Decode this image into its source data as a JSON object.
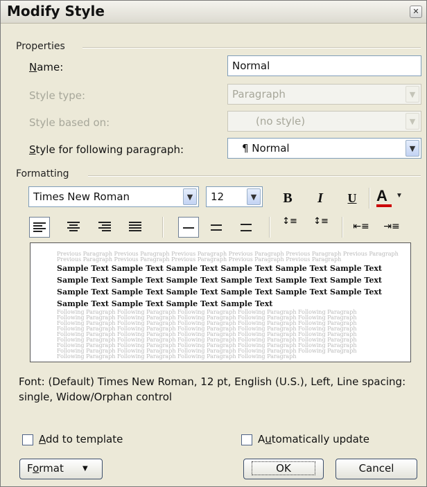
{
  "window": {
    "title": "Modify Style"
  },
  "properties": {
    "group_label": "Properties",
    "name_label": "Name:",
    "name_value": "Normal",
    "style_type_label": "Style type:",
    "style_type_value": "Paragraph",
    "based_on_label": "Style based on:",
    "based_on_value": "(no style)",
    "following_label": "Style for following paragraph:",
    "following_value": "¶ Normal"
  },
  "formatting": {
    "group_label": "Formatting",
    "font_name": "Times New Roman",
    "font_size": "12",
    "bold_label": "B",
    "italic_label": "I",
    "underline_label": "U",
    "font_color_label": "A",
    "font_color": "#cc0000"
  },
  "preview": {
    "previous_lines": [
      "Previous Paragraph Previous Paragraph Previous Paragraph Previous Paragraph Previous Paragraph Previous Paragraph",
      "Previous Paragraph Previous Paragraph Previous Paragraph Previous Paragraph Previous Paragraph"
    ],
    "sample_lines": [
      "Sample Text Sample Text Sample Text Sample Text Sample Text Sample Text",
      "Sample Text Sample Text Sample Text Sample Text Sample Text Sample Text",
      "Sample Text Sample Text Sample Text Sample Text Sample Text Sample Text",
      "Sample Text Sample Text Sample Text Sample Text"
    ],
    "following_lines": [
      "Following Paragraph Following Paragraph Following Paragraph Following Paragraph Following Paragraph",
      "Following Paragraph Following Paragraph Following Paragraph Following Paragraph Following Paragraph",
      "Following Paragraph Following Paragraph Following Paragraph Following Paragraph Following Paragraph",
      "Following Paragraph Following Paragraph Following Paragraph Following Paragraph Following Paragraph",
      "Following Paragraph Following Paragraph Following Paragraph Following Paragraph Following Paragraph",
      "Following Paragraph Following Paragraph Following Paragraph Following Paragraph Following Paragraph",
      "Following Paragraph Following Paragraph Following Paragraph Following Paragraph Following Paragraph",
      "Following Paragraph Following Paragraph Following Paragraph Following Paragraph Following Paragraph",
      "Following Paragraph Following Paragraph Following Paragraph Following Paragraph"
    ]
  },
  "description": "Font: (Default) Times New Roman, 12 pt, English (U.S.), Left, Line spacing:  single, Widow/Orphan control",
  "options": {
    "add_to_template_label": "Add to template",
    "add_to_template_checked": false,
    "auto_update_label": "Automatically update",
    "auto_update_checked": false
  },
  "buttons": {
    "format_label": "Format",
    "ok_label": "OK",
    "cancel_label": "Cancel"
  }
}
